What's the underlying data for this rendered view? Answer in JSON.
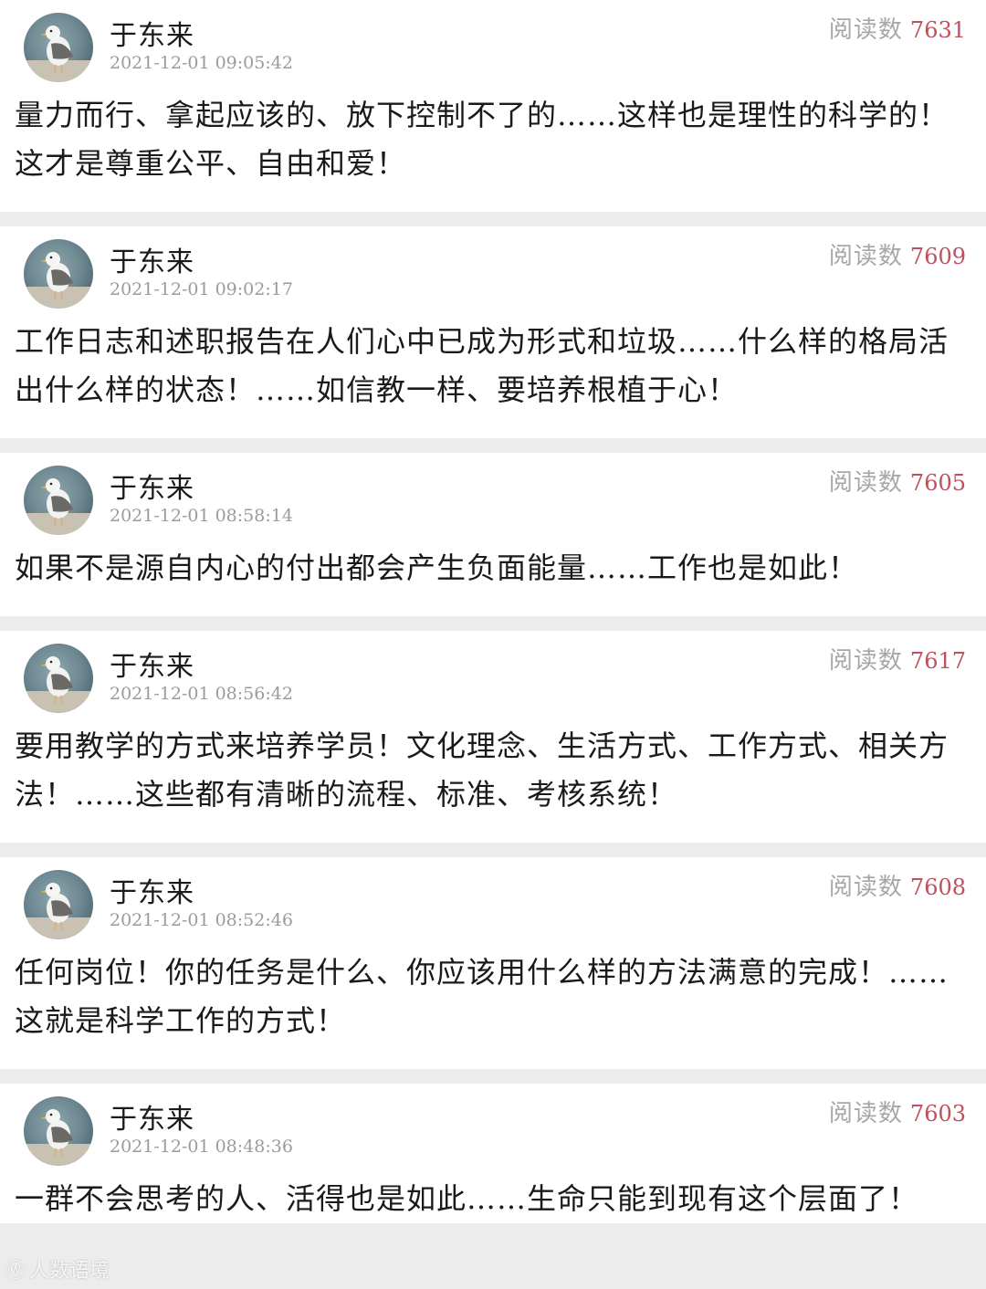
{
  "colors": {
    "read_count": "#c0505c",
    "label": "#a7a7a7",
    "background": "#ececec"
  },
  "posts": [
    {
      "author": "于东来",
      "time": "2021-12-01 09:05:42",
      "read_label": "阅读数",
      "read_count": "7631",
      "lines": [
        "量力而行、拿起应该的、放下控制不了的……这样也是理性的科学的！",
        "这才是尊重公平、自由和爱！"
      ]
    },
    {
      "author": "于东来",
      "time": "2021-12-01 09:02:17",
      "read_label": "阅读数",
      "read_count": "7609",
      "lines": [
        "工作日志和述职报告在人们心中已成为形式和垃圾……什么样的格局活",
        "出什么样的状态！……如信教一样、要培养根植于心！"
      ]
    },
    {
      "author": "于东来",
      "time": "2021-12-01 08:58:14",
      "read_label": "阅读数",
      "read_count": "7605",
      "lines": [
        "如果不是源自内心的付出都会产生负面能量……工作也是如此！"
      ]
    },
    {
      "author": "于东来",
      "time": "2021-12-01 08:56:42",
      "read_label": "阅读数",
      "read_count": "7617",
      "lines": [
        "要用教学的方式来培养学员！文化理念、生活方式、工作方式、相关方",
        "法！……这些都有清晰的流程、标准、考核系统！"
      ]
    },
    {
      "author": "于东来",
      "time": "2021-12-01 08:52:46",
      "read_label": "阅读数",
      "read_count": "7608",
      "lines": [
        "任何岗位！你的任务是什么、你应该用什么样的方法满意的完成！……",
        "这就是科学工作的方式！"
      ]
    },
    {
      "author": "于东来",
      "time": "2021-12-01 08:48:36",
      "read_label": "阅读数",
      "read_count": "7603",
      "lines": [
        "一群不会思考的人、活得也是如此……生命只能到现有这个层面了！"
      ]
    }
  ],
  "watermark": {
    "icon": "weibo-logo-icon",
    "text": "人数语境"
  }
}
